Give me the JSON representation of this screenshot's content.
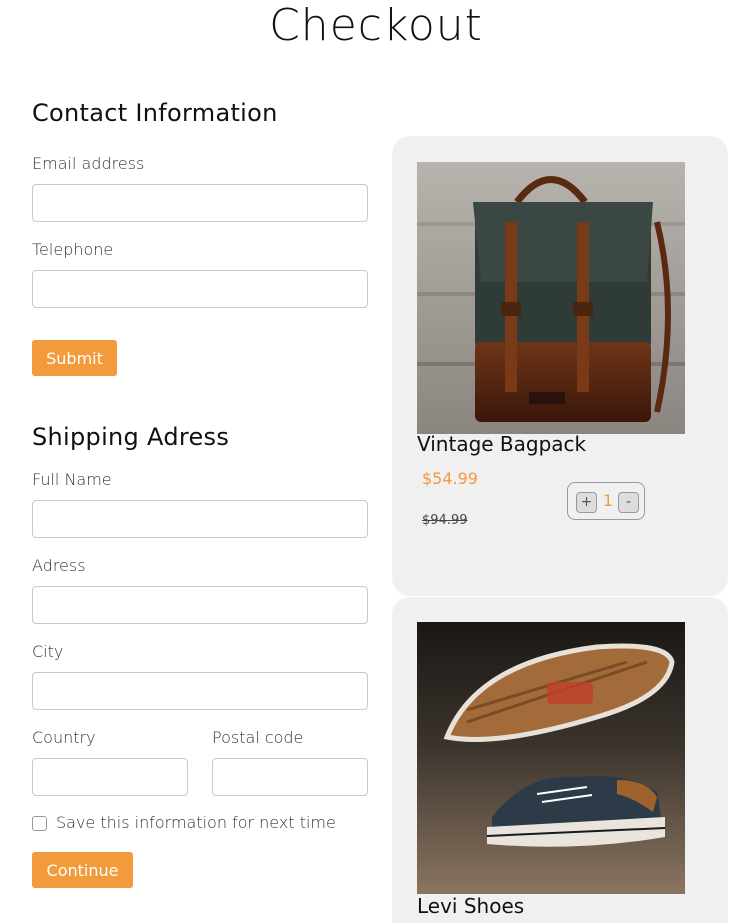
{
  "page": {
    "title": "Checkout"
  },
  "contact": {
    "heading": "Contact Information",
    "email_label": "Email address",
    "email_value": "",
    "telephone_label": "Telephone",
    "telephone_value": "",
    "submit_label": "Submit"
  },
  "shipping": {
    "heading": "Shipping Adress",
    "full_name_label": "Full Name",
    "address_label": "Adress",
    "city_label": "City",
    "country_label": "Country",
    "postal_label": "Postal code",
    "save_info_label": "Save this information for next time",
    "save_info_checked": false,
    "continue_label": "Continue"
  },
  "cart": {
    "items": [
      {
        "name": "Vintage Bagpack",
        "price": "$54.99",
        "old_price": "$94.99",
        "quantity": "1",
        "increment_symbol": "+",
        "decrement_symbol": "-",
        "image_icon": "backpack-photo"
      },
      {
        "name": "Levi Shoes",
        "image_icon": "sneaker-photo"
      }
    ]
  },
  "colors": {
    "accent": "#f39a3c",
    "card_background": "#f0f0f0"
  }
}
